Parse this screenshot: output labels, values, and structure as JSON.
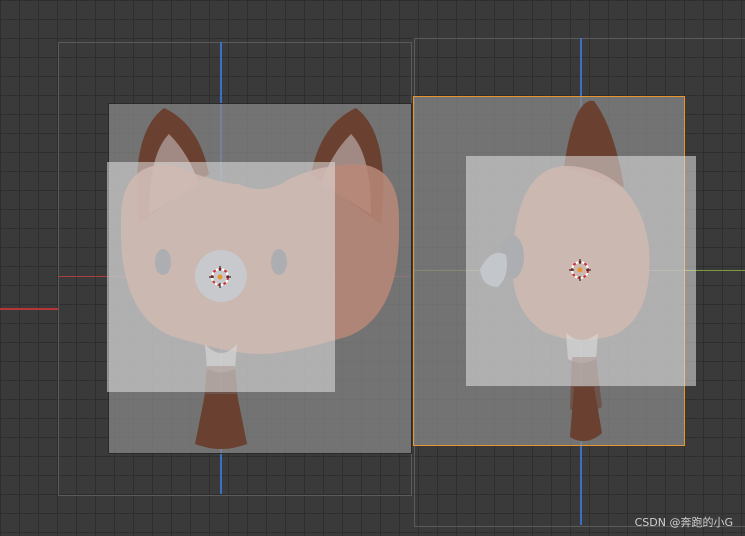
{
  "viewport": {
    "background": "#3a3a3a",
    "grid_color": "#2e2e2e",
    "x_axis_color": "#c83b3b",
    "y_axis_color": "#8aa63a",
    "z_axis_color": "#3d6fc4",
    "selection_color": "#e8952d"
  },
  "views": [
    {
      "name": "front-view",
      "label": "",
      "selected": false
    },
    {
      "name": "side-view",
      "label": "",
      "selected": true
    }
  ],
  "icons": [
    "3d-cursor-icon"
  ],
  "watermark": {
    "text": "CSDN @奔跑的小G"
  }
}
